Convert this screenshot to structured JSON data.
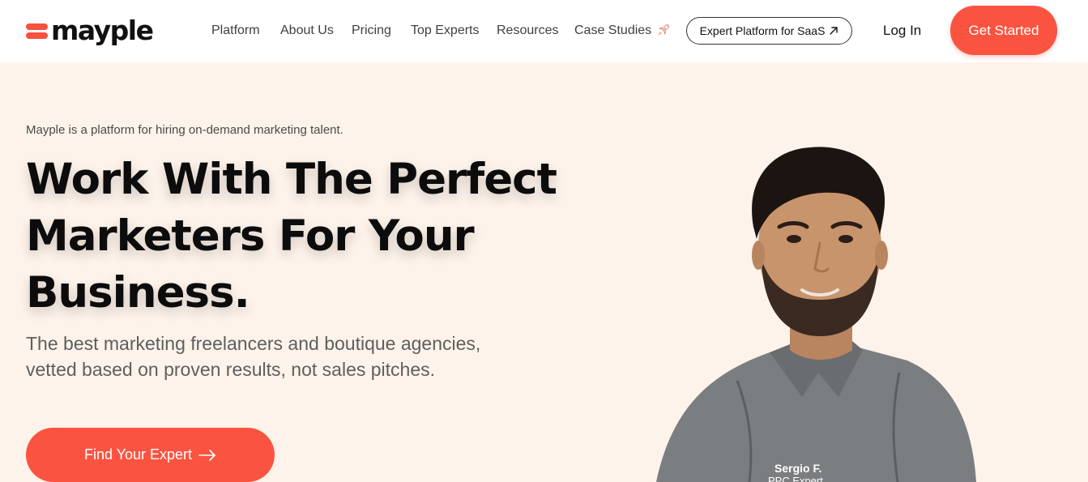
{
  "brand": {
    "name": "mayple",
    "accent": "#fa5441",
    "background": "#fdf3ea"
  },
  "nav": {
    "items": [
      {
        "label": "Platform"
      },
      {
        "label": "About Us"
      },
      {
        "label": "Pricing"
      },
      {
        "label": "Top Experts"
      },
      {
        "label": "Resources"
      },
      {
        "label": "Case Studies",
        "icon": "rocket-icon"
      }
    ],
    "saas_button": "Expert Platform for SaaS",
    "login": "Log In",
    "cta": "Get Started"
  },
  "hero": {
    "tagline": "Mayple is a platform for hiring on-demand marketing talent.",
    "headline_lines": [
      "Work With The Perfect",
      "Marketers For Your",
      "Business."
    ],
    "subhead_lines": [
      "The best marketing freelancers and boutique agencies,",
      "vetted based on proven results, not sales pitches."
    ],
    "cta": "Find Your Expert"
  },
  "expert": {
    "name": "Sergio F.",
    "role": "PPC Expert"
  }
}
